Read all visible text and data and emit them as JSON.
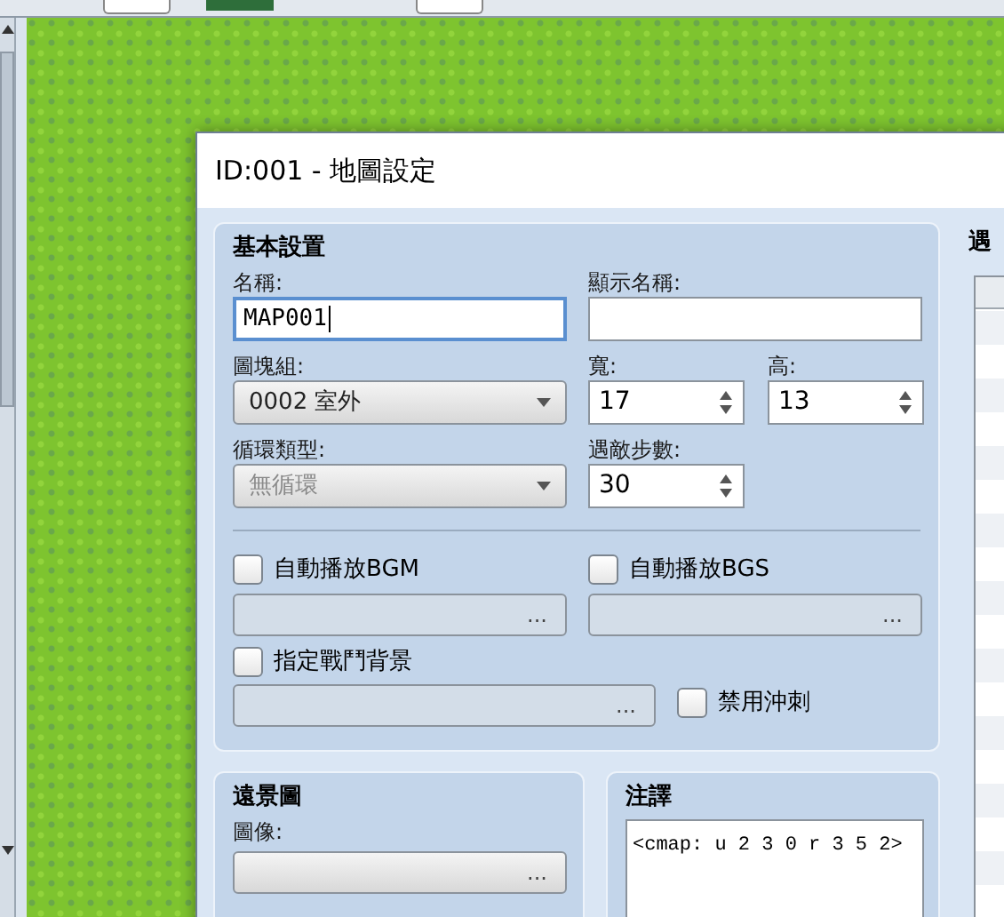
{
  "window": {
    "title": "ID:001 - 地圖設定"
  },
  "basic": {
    "title": "基本設置",
    "name": {
      "label": "名稱:",
      "value": "MAP001",
      "focused": true
    },
    "display_name": {
      "label": "顯示名稱:",
      "focused": false
    },
    "tileset": {
      "label": "圖塊組:",
      "value": "0002 室外",
      "disabled": false
    },
    "width": {
      "label": "寬:",
      "value": "17"
    },
    "height": {
      "label": "高:",
      "value": "13"
    },
    "scroll_type": {
      "label": "循環類型:",
      "value": "無循環",
      "disabled": true
    },
    "encounter_steps": {
      "label": "遇敵步數:",
      "value": "30"
    },
    "bgm": {
      "label": "自動播放BGM",
      "checked": false,
      "button": "..."
    },
    "bgs": {
      "label": "自動播放BGS",
      "checked": false,
      "button": "..."
    },
    "battleback": {
      "label": "指定戰鬥背景",
      "checked": false,
      "button": "..."
    },
    "disable_dash": {
      "label": "禁用沖刺",
      "checked": false
    }
  },
  "parallax": {
    "title": "遠景圖",
    "image": {
      "label": "圖像:",
      "button": "..."
    }
  },
  "note": {
    "title": "注譯",
    "text": "<cmap: u 2 3 0 r 3 5 2>"
  },
  "encounters": {
    "title": "遇"
  }
}
